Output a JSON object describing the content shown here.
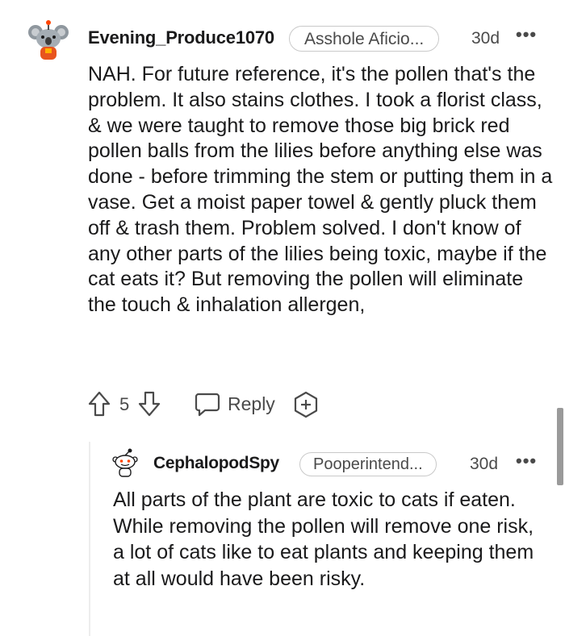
{
  "comments": [
    {
      "username": "Evening_Produce1070",
      "flair": "Asshole Aficio...",
      "time": "30d",
      "more": "•••",
      "avatar_icon": "snoo-koala-avatar",
      "body": "NAH. For future reference, it's the pollen that's the problem. It also stains clothes. I took a florist class, & we were taught to remove those big brick red pollen balls from the lilies before anything else was done - before trimming the stem or putting them in a vase. Get a moist paper towel & gently pluck them off & trash them. Problem solved. I don't know of any other parts of the lilies being toxic, maybe if the cat eats it? But removing the pollen will eliminate the touch & inhalation allergen,",
      "votes": "5",
      "reply_label": "Reply"
    },
    {
      "username": "CephalopodSpy",
      "flair": "Pooperintend...",
      "time": "30d",
      "more": "•••",
      "avatar_icon": "snoo-default-avatar",
      "body": "All parts of the plant are toxic to cats if eaten. While removing the pollen will remove one risk, a lot of cats like to eat plants and keeping them at all would have been risky."
    }
  ],
  "colors": {
    "text": "#1a1a1b",
    "meta": "#4a4a4a",
    "flair_border": "#c9c9c9",
    "thread_line": "#ededed"
  }
}
